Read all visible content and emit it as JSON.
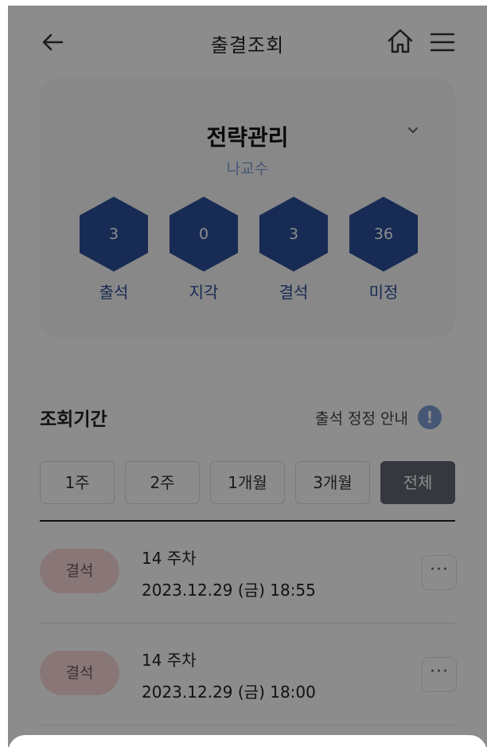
{
  "header": {
    "title": "출결조회",
    "back_icon": "arrow-left-icon",
    "home_icon": "home-icon",
    "menu_icon": "hamburger-menu-icon"
  },
  "course": {
    "name": "전략관리",
    "professor": "나교수",
    "toggle_icon": "chevron-down-icon",
    "stats": [
      {
        "count": "3",
        "label": "출석"
      },
      {
        "count": "0",
        "label": "지각"
      },
      {
        "count": "3",
        "label": "결석"
      },
      {
        "count": "36",
        "label": "미정"
      }
    ]
  },
  "period": {
    "title": "조회기간",
    "notice_label": "출석 정정 안내",
    "notice_icon": "exclamation-icon",
    "tabs": [
      {
        "label": "1주"
      },
      {
        "label": "2주"
      },
      {
        "label": "1개월"
      },
      {
        "label": "3개월"
      },
      {
        "label": "전체",
        "active": true
      }
    ]
  },
  "records": [
    {
      "status": "결석",
      "week": "14 주차",
      "datetime": "2023.12.29 (금) 18:55"
    },
    {
      "status": "결석",
      "week": "14 주차",
      "datetime": "2023.12.29 (금) 18:00"
    }
  ],
  "colors": {
    "primary": "#2b4f99",
    "absent_badge_bg": "#f9d9d9",
    "active_tab_bg": "#616771",
    "info_icon": "#7f9fd6",
    "overlay": "rgba(0,0,0,0.45)"
  }
}
